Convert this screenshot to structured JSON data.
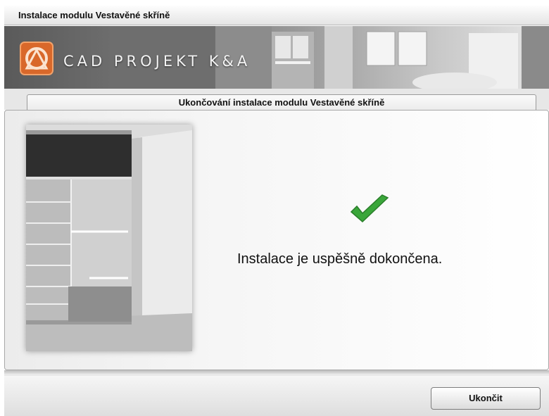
{
  "window": {
    "title": "Instalace modulu Vestavěné skříně"
  },
  "banner": {
    "logo_text": "CAD PROJEKT K&A",
    "logo_icon": "cad-projekt-logo-icon"
  },
  "tab": {
    "label": "Ukončování instalace modulu Vestavěné skříně"
  },
  "main": {
    "status_icon": "checkmark-icon",
    "message": "Instalace je uspěšně dokončena."
  },
  "footer": {
    "finish_button_label": "Ukončit"
  },
  "colors": {
    "check_green": "#3aa63a",
    "logo_orange": "#e0762a"
  }
}
